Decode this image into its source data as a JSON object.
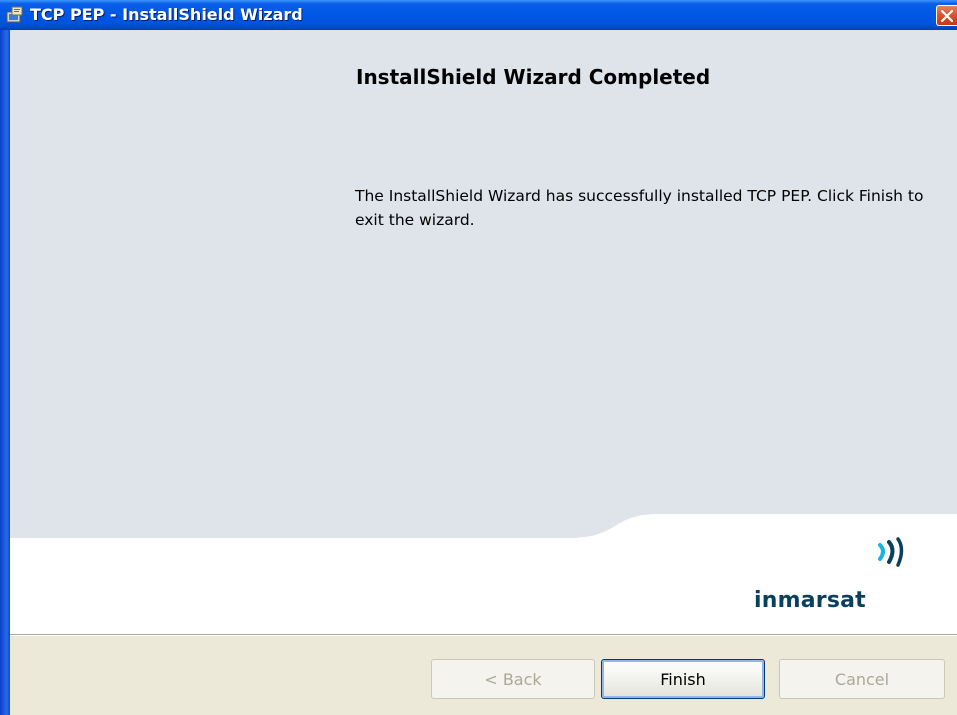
{
  "window": {
    "title": "TCP PEP - InstallShield Wizard",
    "icon": "installer-icon",
    "close_icon": "close-icon"
  },
  "content": {
    "heading": "InstallShield Wizard Completed",
    "message": "The InstallShield Wizard has successfully installed TCP PEP. Click Finish to exit the wizard."
  },
  "logo": {
    "text": "inmarsat",
    "icon": "inmarsat-waves-icon",
    "color": "#0B3F5E",
    "accent": "#19B5E0"
  },
  "buttons": {
    "back": {
      "label": "< Back",
      "enabled": false
    },
    "finish": {
      "label": "Finish",
      "enabled": true
    },
    "cancel": {
      "label": "Cancel",
      "enabled": false
    }
  },
  "colors": {
    "title_bar": "#0054DF",
    "panel": "#DFE4EB",
    "dialog_bg": "#ECE9D8",
    "close_button": "#D9502C"
  }
}
